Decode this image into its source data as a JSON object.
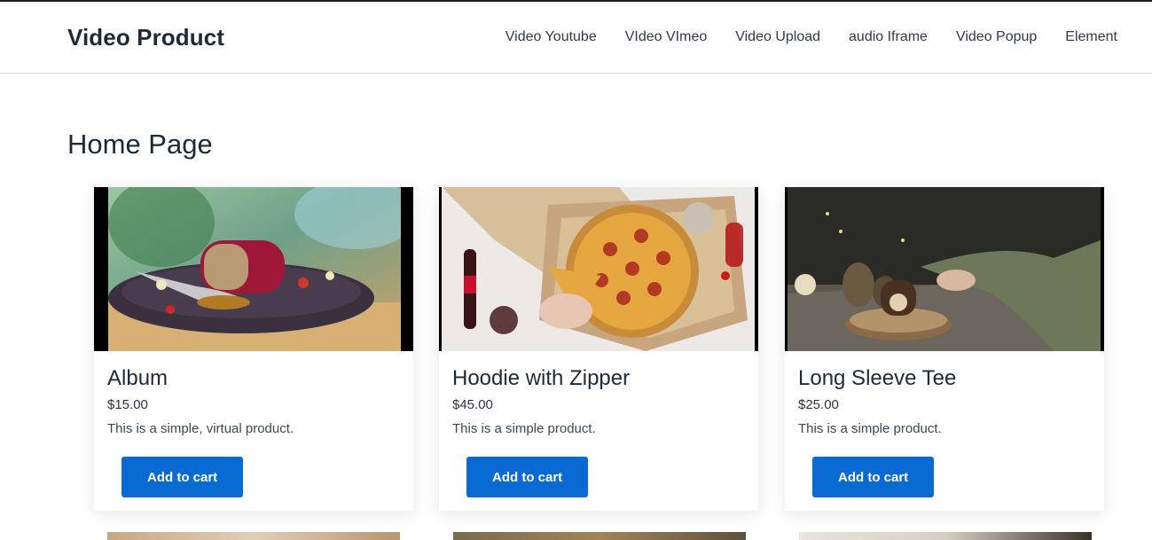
{
  "site": {
    "title": "Video Product"
  },
  "nav": {
    "items": [
      {
        "label": "Video Youtube"
      },
      {
        "label": "VIdeo VImeo"
      },
      {
        "label": "Video Upload"
      },
      {
        "label": "audio Iframe"
      },
      {
        "label": "Video Popup"
      },
      {
        "label": "Element"
      }
    ]
  },
  "page": {
    "title": "Home Page"
  },
  "products": [
    {
      "name": "Album",
      "price": "$15.00",
      "description": "This is a simple, virtual product.",
      "button": "Add to cart",
      "image": "dessert-plate"
    },
    {
      "name": "Hoodie with Zipper",
      "price": "$45.00",
      "description": "This is a simple product.",
      "button": "Add to cart",
      "image": "pizza-box"
    },
    {
      "name": "Long Sleeve Tee",
      "price": "$25.00",
      "description": "This is a simple product.",
      "button": "Add to cart",
      "image": "wooden-table-cake"
    }
  ],
  "colors": {
    "accent": "#0a6ad4",
    "text": "#1e2a36"
  }
}
